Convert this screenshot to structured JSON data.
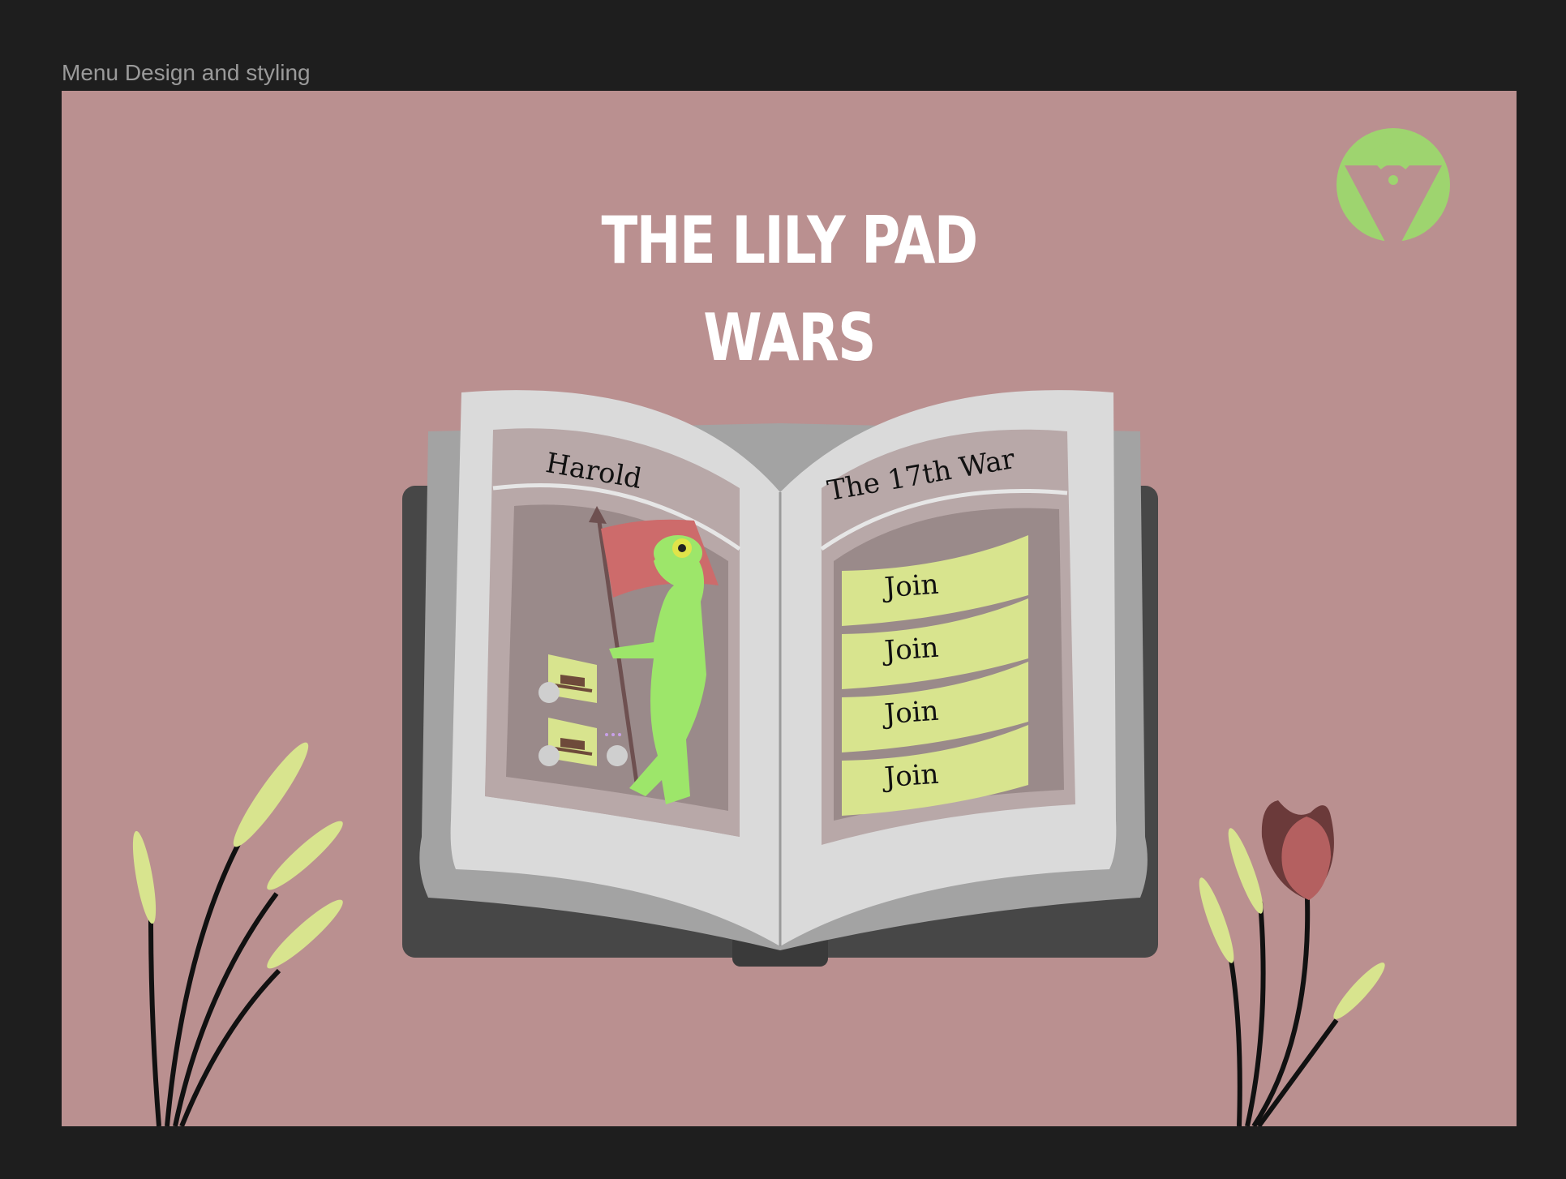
{
  "frame": {
    "label": "Menu Design and styling"
  },
  "title": {
    "line1": "THE LILY PAD",
    "line2": "WARS"
  },
  "book": {
    "left_page": {
      "tab_label": "Harold"
    },
    "right_page": {
      "tab_label": "The 17th War",
      "join_buttons": [
        "Join",
        "Join",
        "Join",
        "Join"
      ]
    }
  },
  "icons": {
    "logo": "wifi-badge-icon",
    "banner": "frog-warrior-illustration",
    "hat_cards": "hat-card-icon"
  },
  "colors": {
    "background": "#ba9090",
    "frame": "#1e1e1e",
    "accent_green": "#9ed46f",
    "button": "#d8e48e",
    "page": "#dadada",
    "cover": "#474747"
  }
}
